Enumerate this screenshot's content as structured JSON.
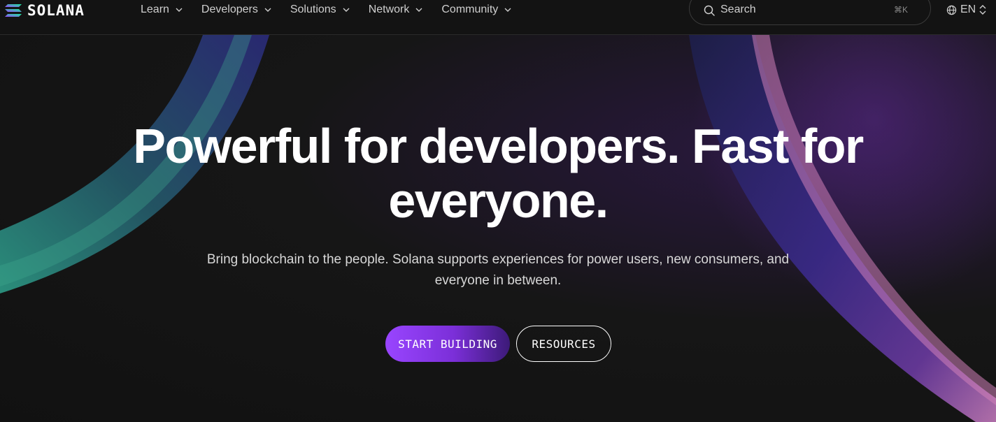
{
  "brand": {
    "name": "SOLANA",
    "logo_icon": "solana-logo-icon"
  },
  "nav": {
    "items": [
      {
        "label": "Learn",
        "icon": "chevron-down-icon"
      },
      {
        "label": "Developers",
        "icon": "chevron-down-icon"
      },
      {
        "label": "Solutions",
        "icon": "chevron-down-icon"
      },
      {
        "label": "Network",
        "icon": "chevron-down-icon"
      },
      {
        "label": "Community",
        "icon": "chevron-down-icon"
      }
    ],
    "search": {
      "placeholder": "Search",
      "shortcut": "⌘K",
      "icon": "search-icon"
    },
    "language": {
      "label": "EN",
      "icon": "globe-icon",
      "toggle_icon": "up-down-chevron-icon"
    }
  },
  "hero": {
    "headline": "Powerful for developers. Fast for everyone.",
    "subtitle": "Bring blockchain to the people. Solana supports experiences for power users, new consumers, and everyone in between.",
    "primary_cta": "START BUILDING",
    "secondary_cta": "RESOURCES"
  },
  "colors": {
    "background": "#141414",
    "brand_purple": "#9945ff",
    "brand_green": "#14f195",
    "text": "#ffffff"
  }
}
